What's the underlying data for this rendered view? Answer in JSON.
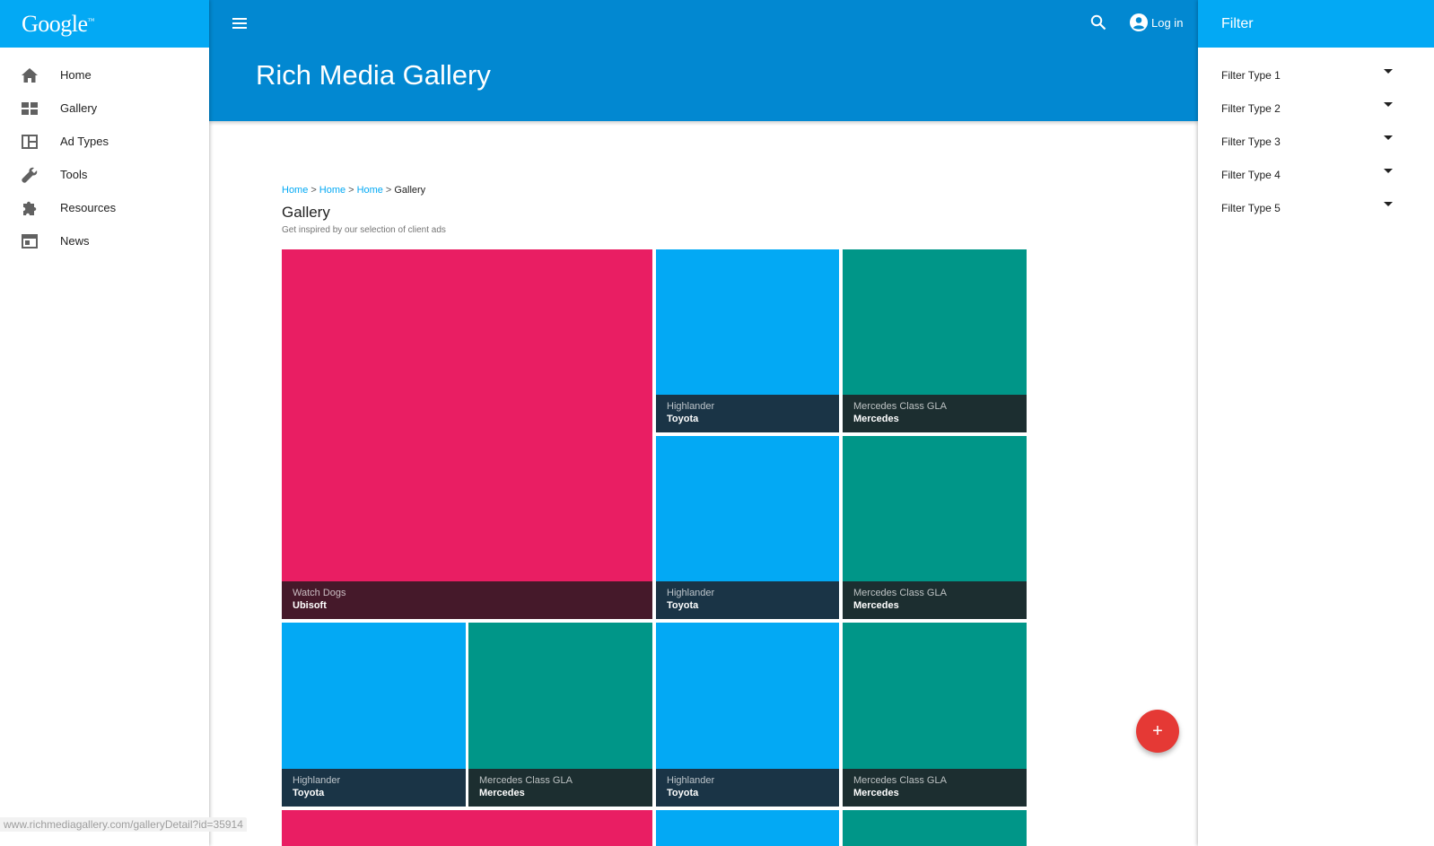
{
  "logo": {
    "text": "Google",
    "mark": "™"
  },
  "sidebar": {
    "items": [
      {
        "label": "Home",
        "icon": "home-icon"
      },
      {
        "label": "Gallery",
        "icon": "grid-icon"
      },
      {
        "label": "Ad Types",
        "icon": "layout-icon"
      },
      {
        "label": "Tools",
        "icon": "wrench-icon"
      },
      {
        "label": "Resources",
        "icon": "puzzle-icon"
      },
      {
        "label": "News",
        "icon": "news-icon"
      }
    ]
  },
  "header": {
    "title": "Rich Media Gallery",
    "login_label": "Log in"
  },
  "breadcrumb": {
    "items": [
      "Home",
      "Home",
      "Home"
    ],
    "current": "Gallery",
    "separator": ">"
  },
  "section": {
    "title": "Gallery",
    "subtitle": "Get inspired by our selection of client ads"
  },
  "gallery": {
    "tiles": [
      {
        "title": "Watch Dogs",
        "subtitle": "Ubisoft",
        "color": "pink"
      },
      {
        "title": "Highlander",
        "subtitle": "Toyota",
        "color": "blue"
      },
      {
        "title": "Mercedes Class GLA",
        "subtitle": "Mercedes",
        "color": "teal"
      },
      {
        "title": "Highlander",
        "subtitle": "Toyota",
        "color": "blue"
      },
      {
        "title": "Mercedes Class GLA",
        "subtitle": "Mercedes",
        "color": "teal"
      },
      {
        "title": "Highlander",
        "subtitle": "Toyota",
        "color": "blue"
      },
      {
        "title": "Mercedes Class GLA",
        "subtitle": "Mercedes",
        "color": "teal"
      },
      {
        "title": "Highlander",
        "subtitle": "Toyota",
        "color": "blue"
      },
      {
        "title": "Mercedes Class GLA",
        "subtitle": "Mercedes",
        "color": "teal"
      }
    ]
  },
  "fab": {
    "label": "+"
  },
  "filter": {
    "title": "Filter",
    "items": [
      "Filter Type 1",
      "Filter Type 2",
      "Filter Type 3",
      "Filter Type 4",
      "Filter Type 5"
    ]
  },
  "status_bar": {
    "url": "www.richmediagallery.com/galleryDetail?id=35914"
  },
  "colors": {
    "primary": "#03a9f4",
    "primary_dark": "#0288d1",
    "pink": "#e91e63",
    "teal": "#009688",
    "fab": "#e53935"
  }
}
